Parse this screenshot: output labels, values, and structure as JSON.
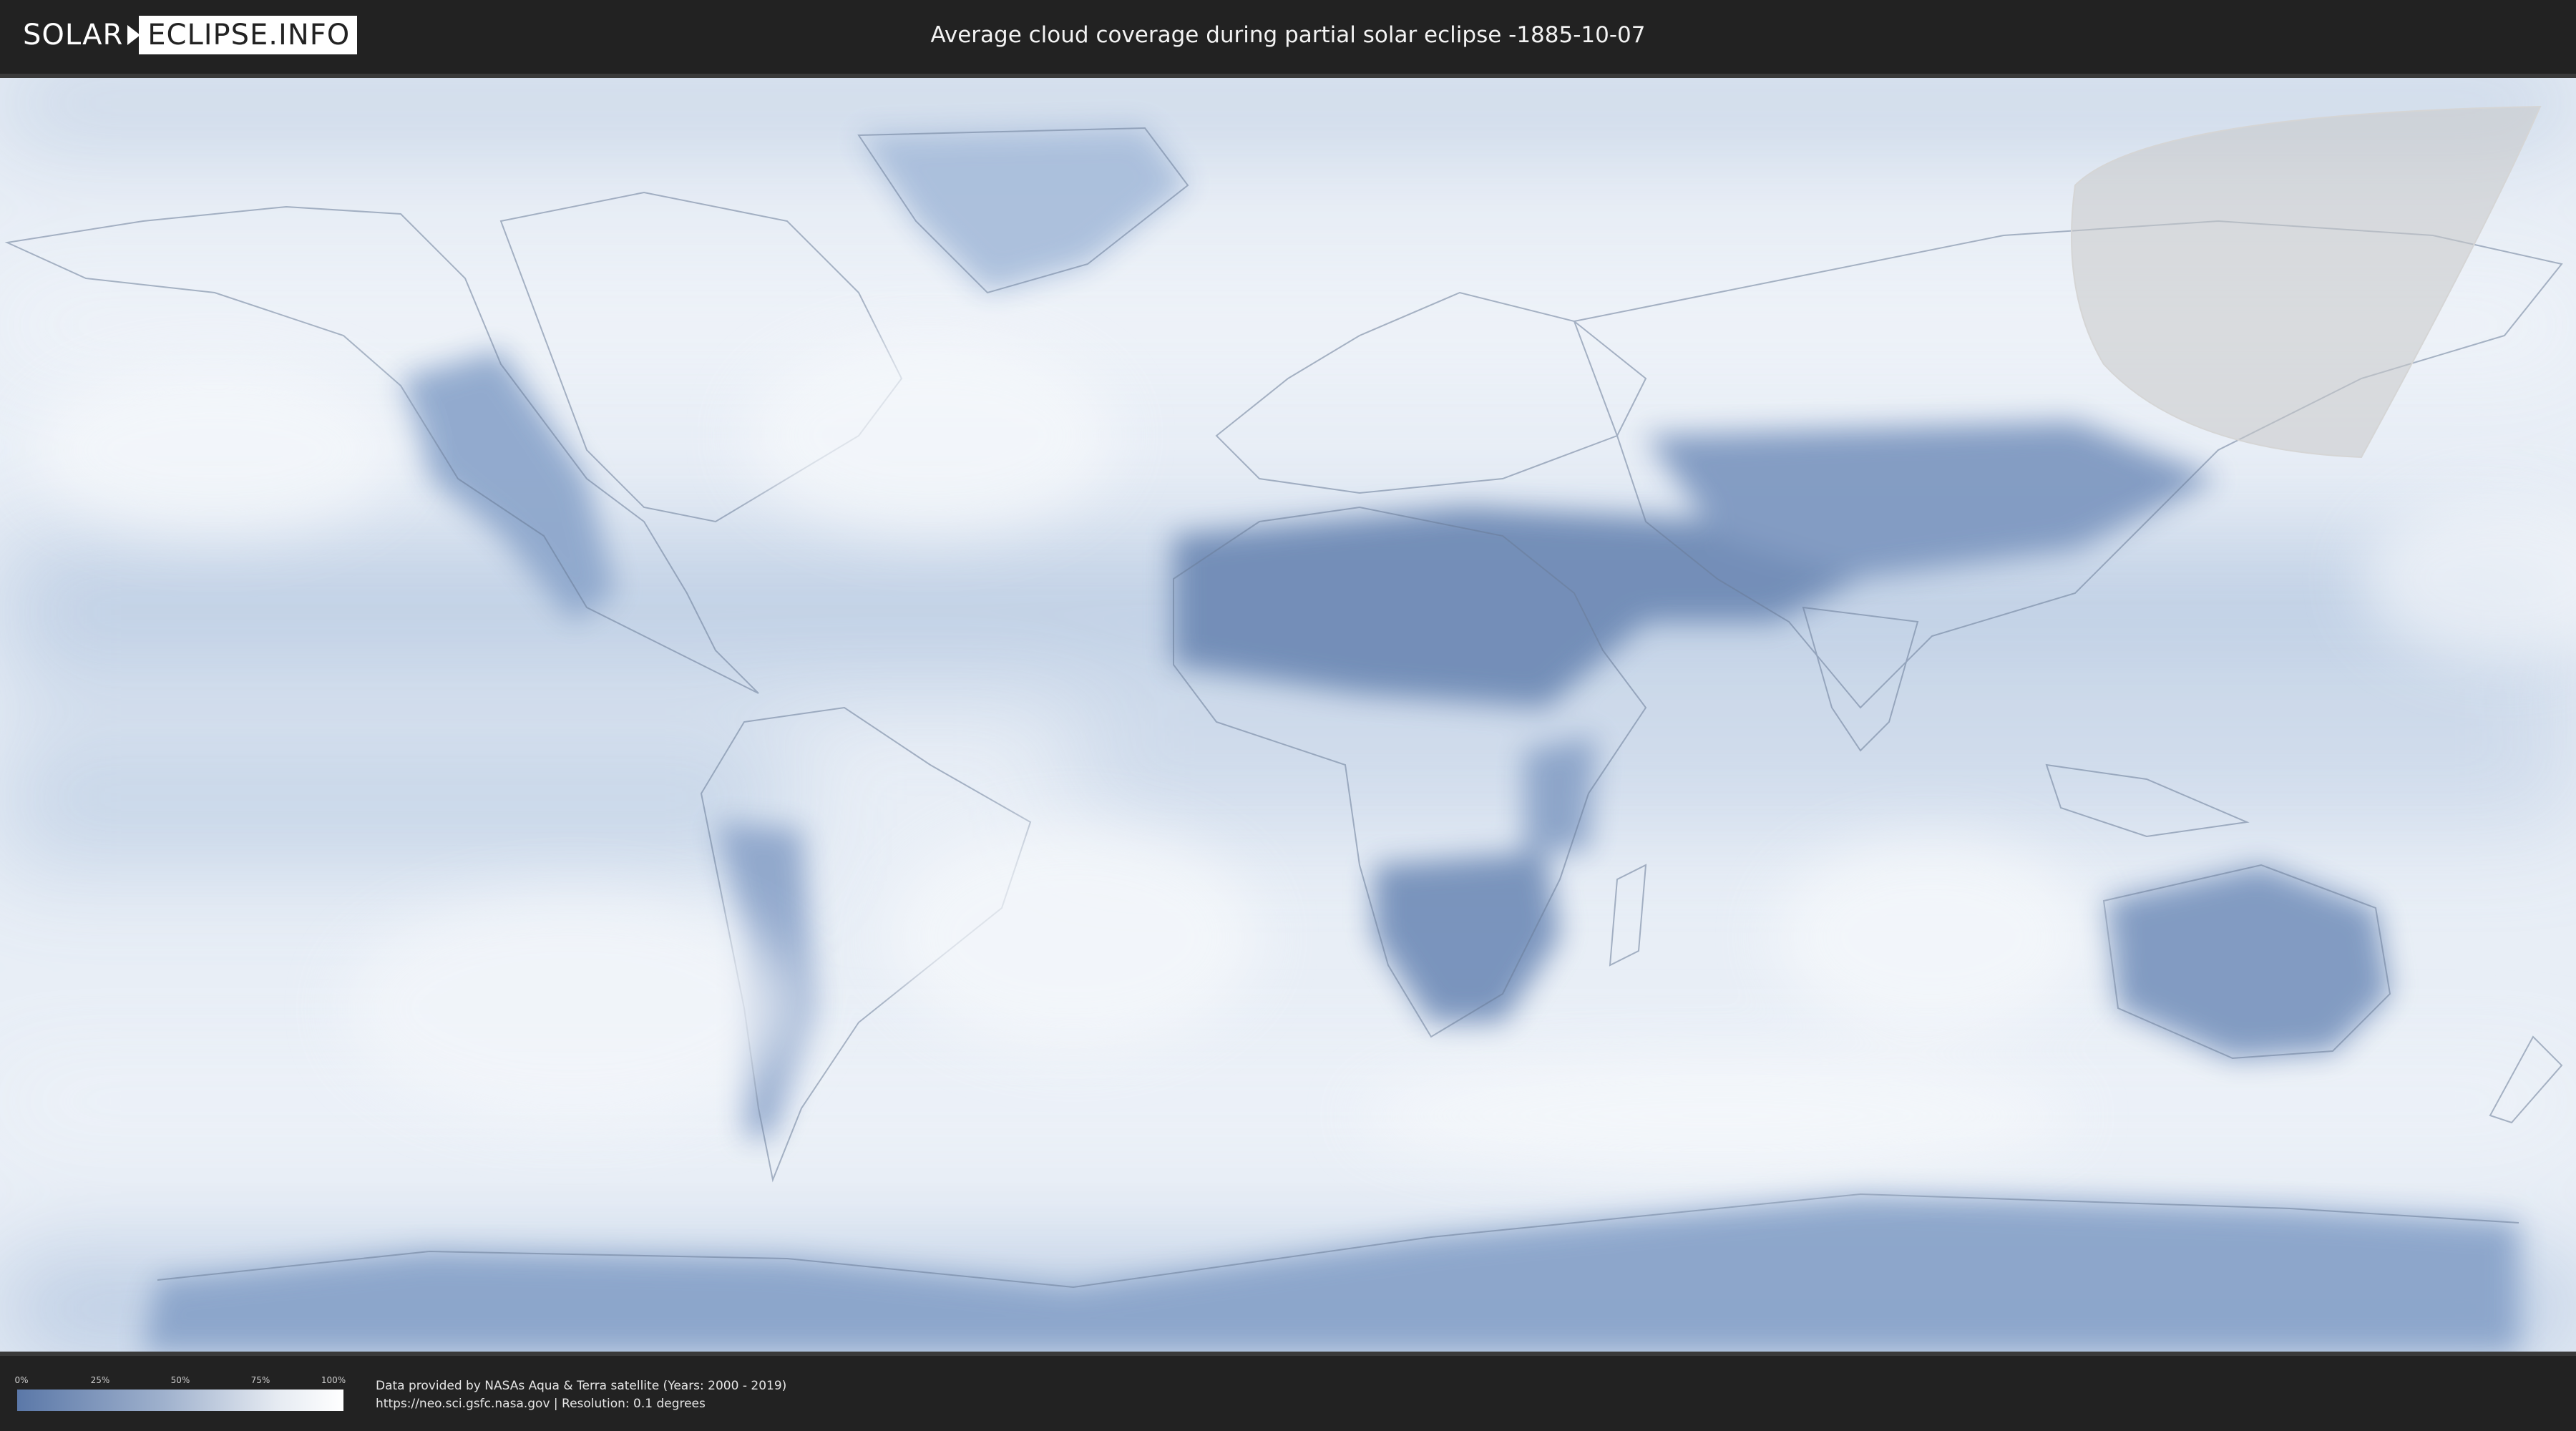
{
  "header": {
    "logo_left": "SOLAR",
    "logo_right": "ECLIPSE.INFO",
    "title": "Average cloud coverage during partial solar eclipse -1885-10-07"
  },
  "legend": {
    "ticks": [
      "0%",
      "25%",
      "50%",
      "75%",
      "100%"
    ],
    "colors": {
      "low": "#5b78a8",
      "high": "#ffffff"
    }
  },
  "credits": {
    "line1": "Data provided by NASAs Aqua & Terra satellite (Years: 2000 - 2019)",
    "line2": "https://neo.sci.gsfc.nasa.gov | Resolution: 0.1 degrees"
  },
  "map": {
    "eclipse_zone_color": "#c8c8c8",
    "land_border_color": "#6a7c98"
  }
}
